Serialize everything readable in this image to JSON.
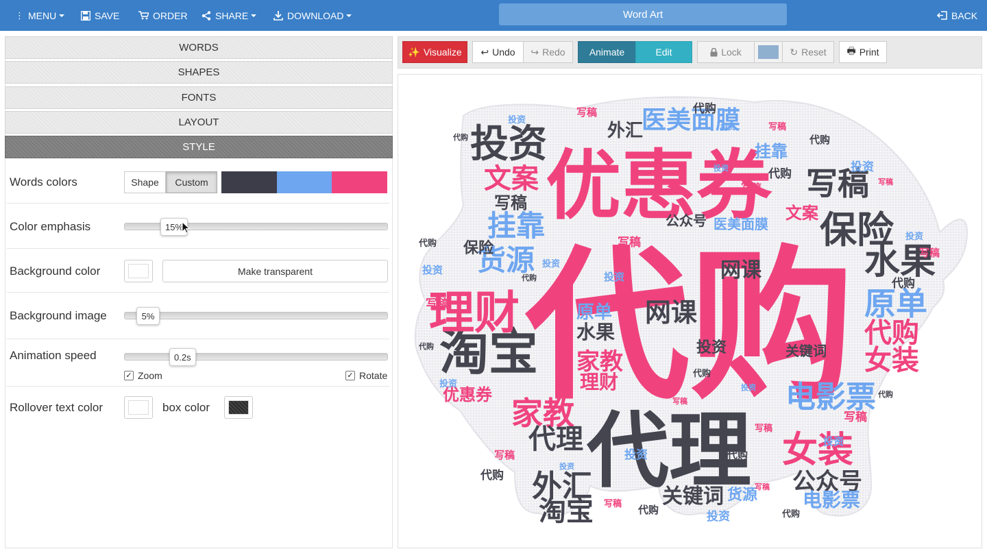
{
  "topbar": {
    "menu": "MENU",
    "save": "SAVE",
    "order": "ORDER",
    "share": "SHARE",
    "download": "DOWNLOAD",
    "title": "Word Art",
    "back": "BACK"
  },
  "accordion": {
    "words": "WORDS",
    "shapes": "SHAPES",
    "fonts": "FONTS",
    "layout": "LAYOUT",
    "style": "STYLE"
  },
  "style_panel": {
    "words_colors": {
      "label": "Words colors",
      "shape_button": "Shape",
      "custom_button": "Custom",
      "swatches": [
        "#3d3d4a",
        "#6ea6f0",
        "#f0437e"
      ]
    },
    "color_emphasis": {
      "label": "Color emphasis",
      "value": "15%",
      "level": 0.15
    },
    "background_color": {
      "label": "Background color",
      "make_transparent": "Make transparent"
    },
    "background_image": {
      "label": "Background image",
      "value": "5%",
      "level": 0.05
    },
    "animation_speed": {
      "label": "Animation speed",
      "value": "0.2s",
      "zoom_label": "Zoom",
      "rotate_label": "Rotate"
    },
    "rollover": {
      "label": "Rollover text color",
      "box_label": "box color"
    }
  },
  "toolbar": {
    "visualize": "Visualize",
    "undo": "Undo",
    "redo": "Redo",
    "animate": "Animate",
    "edit": "Edit",
    "lock": "Lock",
    "lock_color": "#8fb0cf",
    "reset": "Reset",
    "print": "Print"
  },
  "colors": {
    "topbar": "#3a7fc8",
    "dark": "#454550",
    "blue": "#6ea6f0",
    "pink": "#f0437e"
  },
  "word_cloud": {
    "shape": "pig",
    "words": [
      {
        "text": "代购",
        "color": "pink"
      },
      {
        "text": "优惠券",
        "color": "pink"
      },
      {
        "text": "代理",
        "color": "dark"
      },
      {
        "text": "淘宝",
        "color": "dark"
      },
      {
        "text": "理财",
        "color": "pink"
      },
      {
        "text": "水果",
        "color": "dark"
      },
      {
        "text": "保险",
        "color": "dark"
      },
      {
        "text": "投资",
        "color": "dark"
      },
      {
        "text": "原单",
        "color": "blue"
      },
      {
        "text": "电影票",
        "color": "blue"
      },
      {
        "text": "女装",
        "color": "pink"
      },
      {
        "text": "家教",
        "color": "pink"
      },
      {
        "text": "外汇",
        "color": "dark"
      },
      {
        "text": "医美面膜",
        "color": "blue"
      },
      {
        "text": "写稿",
        "color": "dark"
      },
      {
        "text": "文案",
        "color": "pink"
      },
      {
        "text": "挂靠",
        "color": "blue"
      },
      {
        "text": "货源",
        "color": "blue"
      },
      {
        "text": "网课",
        "color": "dark"
      },
      {
        "text": "公众号",
        "color": "dark"
      },
      {
        "text": "关键词",
        "color": "dark"
      }
    ]
  }
}
